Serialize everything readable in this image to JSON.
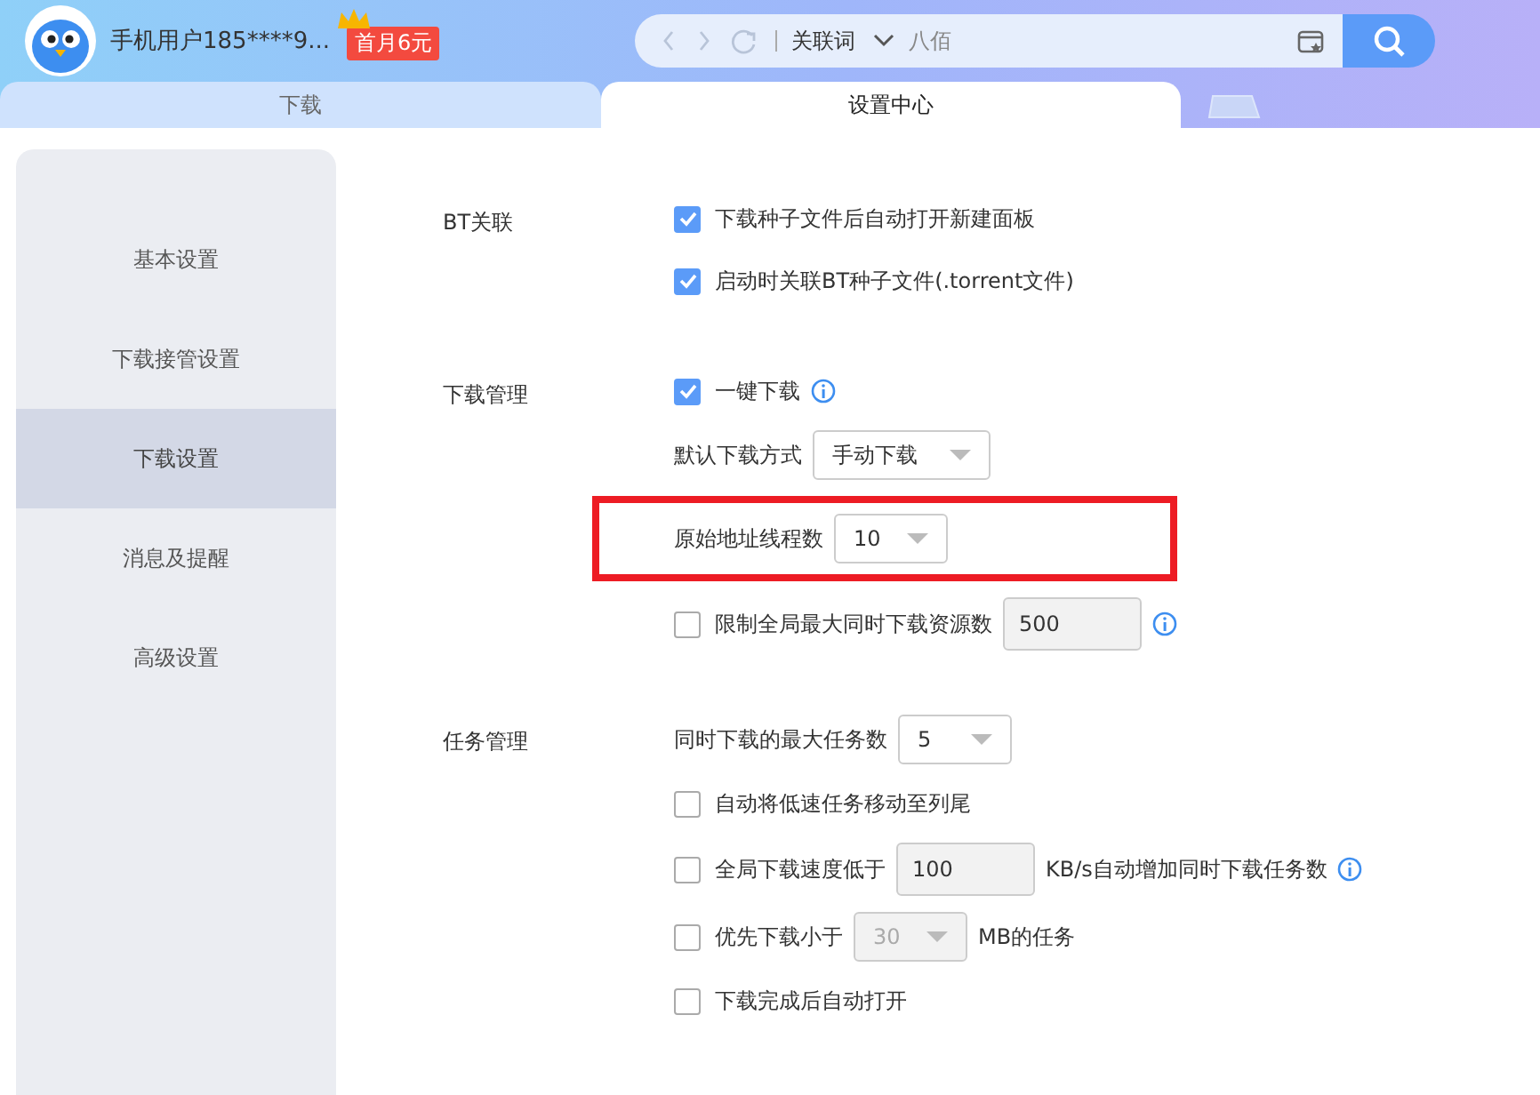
{
  "header": {
    "username": "手机用户185****9...",
    "badge": "首月6元",
    "search": {
      "scope": "关联词",
      "placeholder": "八佰"
    }
  },
  "tabs": [
    {
      "label": "下载",
      "selected": false
    },
    {
      "label": "设置中心",
      "selected": true
    }
  ],
  "sidebar": {
    "items": [
      {
        "label": "基本设置",
        "selected": false
      },
      {
        "label": "下载接管设置",
        "selected": false
      },
      {
        "label": "下载设置",
        "selected": true
      },
      {
        "label": "消息及提醒",
        "selected": false
      },
      {
        "label": "高级设置",
        "selected": false
      }
    ]
  },
  "sections": [
    {
      "label": "BT关联",
      "items": [
        {
          "kind": "checkbox",
          "checked": true,
          "label": "下载种子文件后自动打开新建面板",
          "info": false
        },
        {
          "kind": "checkbox",
          "checked": true,
          "label": "启动时关联BT种子文件(.torrent文件)",
          "info": false
        }
      ]
    },
    {
      "label": "下载管理",
      "items": [
        {
          "kind": "checkbox",
          "checked": true,
          "label": "一键下载",
          "info": true
        },
        {
          "kind": "select",
          "label": "默认下载方式",
          "value": "手动下载",
          "highlighted": false
        },
        {
          "kind": "select",
          "label": "原始地址线程数",
          "value": "10",
          "highlighted": true
        },
        {
          "kind": "checkbox_input",
          "checked": false,
          "label": "限制全局最大同时下载资源数",
          "value": "500",
          "info": true
        }
      ]
    },
    {
      "label": "任务管理",
      "items": [
        {
          "kind": "select",
          "label": "同时下载的最大任务数",
          "value": "5",
          "highlighted": false
        },
        {
          "kind": "checkbox",
          "checked": false,
          "label": "自动将低速任务移动至列尾",
          "info": false
        },
        {
          "kind": "checkbox_input",
          "checked": false,
          "label": "全局下载速度低于",
          "value": "100",
          "suffix": "KB/s自动增加同时下载任务数",
          "info": true
        },
        {
          "kind": "checkbox_select",
          "checked": false,
          "label": "优先下载小于",
          "value": "30",
          "suffix": "MB的任务"
        },
        {
          "kind": "checkbox",
          "checked": false,
          "label": "下载完成后自动打开",
          "info": false
        }
      ]
    }
  ]
}
